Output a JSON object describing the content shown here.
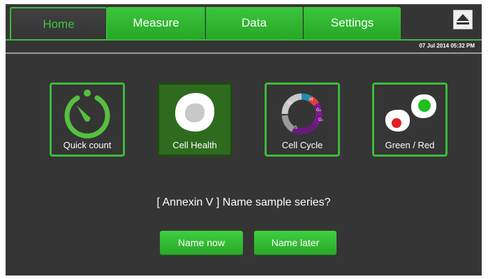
{
  "tabs": [
    {
      "label": "Home",
      "active": true
    },
    {
      "label": "Measure",
      "active": false
    },
    {
      "label": "Data",
      "active": false
    },
    {
      "label": "Settings",
      "active": false
    }
  ],
  "eject_icon": "eject-icon",
  "timestamp": "07 Jul 2014  05:32 PM",
  "tiles": [
    {
      "label": "Quick count",
      "icon": "stopwatch-icon",
      "selected": false
    },
    {
      "label": "Cell Health",
      "icon": "cell-icon",
      "selected": true
    },
    {
      "label": "Cell Cycle",
      "icon": "cell-cycle-icon",
      "selected": false,
      "phases": [
        "G₀",
        "M",
        "G₁",
        "G₂",
        "S"
      ]
    },
    {
      "label": "Green / Red",
      "icon": "green-red-cells-icon",
      "selected": false
    }
  ],
  "prompt": "[ Annexin V ] Name sample series?",
  "buttons": {
    "name_now": "Name now",
    "name_later": "Name later"
  },
  "colors": {
    "background": "#353535",
    "accent": "#3cba3c",
    "selected_tile": "#2e6b1f"
  }
}
